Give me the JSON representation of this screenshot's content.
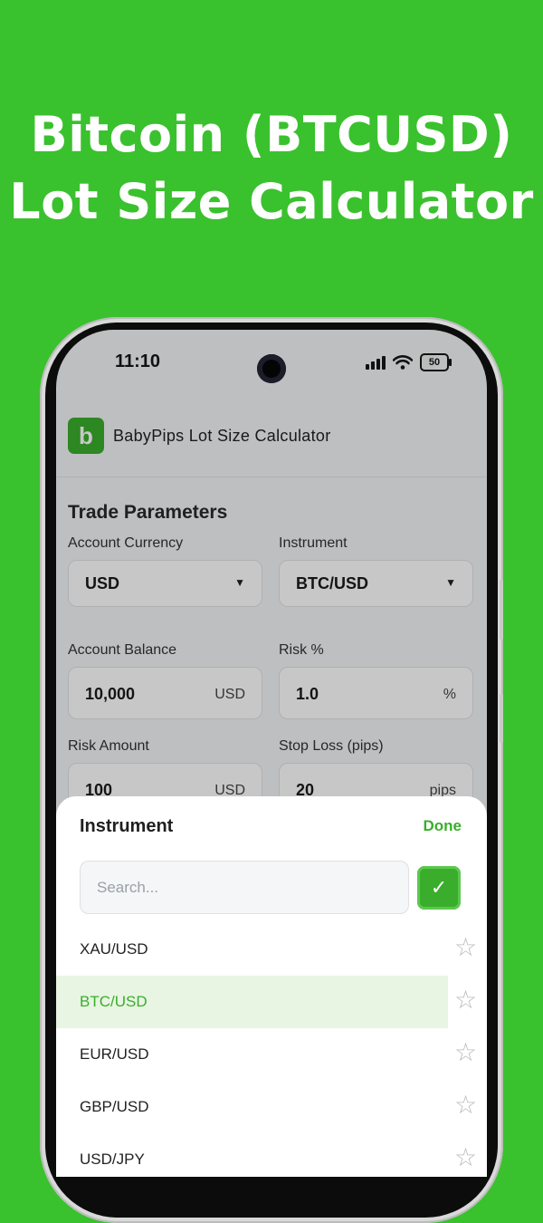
{
  "headline": {
    "line1": "Bitcoin (BTCUSD)",
    "line2": "Lot Size Calculator"
  },
  "status_bar": {
    "time": "11:10",
    "battery": "50"
  },
  "app": {
    "logo_letter": "b",
    "title": "BabyPips Lot Size Calculator"
  },
  "trade_parameters": {
    "title": "Trade Parameters",
    "account_currency": {
      "label": "Account Currency",
      "value": "USD"
    },
    "instrument": {
      "label": "Instrument",
      "value": "BTC/USD"
    },
    "account_balance": {
      "label": "Account Balance",
      "value": "10,000",
      "unit": "USD"
    },
    "risk_percent": {
      "label": "Risk %",
      "value": "1.0",
      "unit": "%"
    },
    "risk_amount": {
      "label": "Risk Amount",
      "value": "100",
      "unit": "USD"
    },
    "stop_loss": {
      "label": "Stop Loss (pips)",
      "value": "20",
      "unit": "pips"
    }
  },
  "sheet": {
    "title": "Instrument",
    "done_label": "Done",
    "search_placeholder": "Search...",
    "items": [
      {
        "name": "XAU/USD",
        "selected": false
      },
      {
        "name": "BTC/USD",
        "selected": true
      },
      {
        "name": "EUR/USD",
        "selected": false
      },
      {
        "name": "GBP/USD",
        "selected": false
      },
      {
        "name": "USD/JPY",
        "selected": false
      }
    ]
  },
  "colors": {
    "background": "#3ac12e",
    "accent": "#3aae2c",
    "selected_row": "#e8f5e2"
  }
}
